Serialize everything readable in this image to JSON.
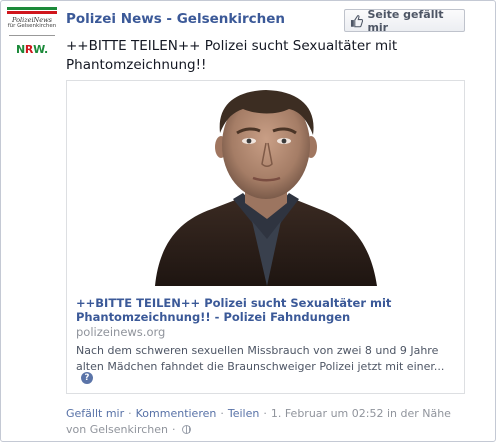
{
  "avatar": {
    "line1": "PolizeiNews",
    "line2": "für Gelsenkirchen",
    "brand_n": "N",
    "brand_r": "R",
    "brand_w": "W."
  },
  "header": {
    "page_name": "Polizei News - Gelsenkirchen",
    "like_label": "Seite gefällt mir"
  },
  "post": {
    "text": "++BITTE TEILEN++ Polizei sucht Sexualtäter mit Phantomzeichnung!!"
  },
  "link": {
    "title": "++BITTE TEILEN++ Polizei sucht Sexualtäter mit Phantomzeichnung!! - Polizei Fahndungen",
    "domain": "polizeinews.org",
    "description": "Nach dem schweren sexuellen Missbrauch von zwei 8 und 9 Jahre alten Mädchen fahndet die Braunschweiger Polizei jetzt mit einer...",
    "help_glyph": "?"
  },
  "footer": {
    "like": "Gefällt mir",
    "comment": "Kommentieren",
    "share": "Teilen",
    "timestamp": "1. Februar um 02:52 in der Nähe von Gelsenkirchen",
    "separator": "·"
  },
  "colors": {
    "link_blue": "#3b5998",
    "muted": "#90949c",
    "nrw_green": "#1c8a3a",
    "nrw_red": "#d0151c"
  }
}
